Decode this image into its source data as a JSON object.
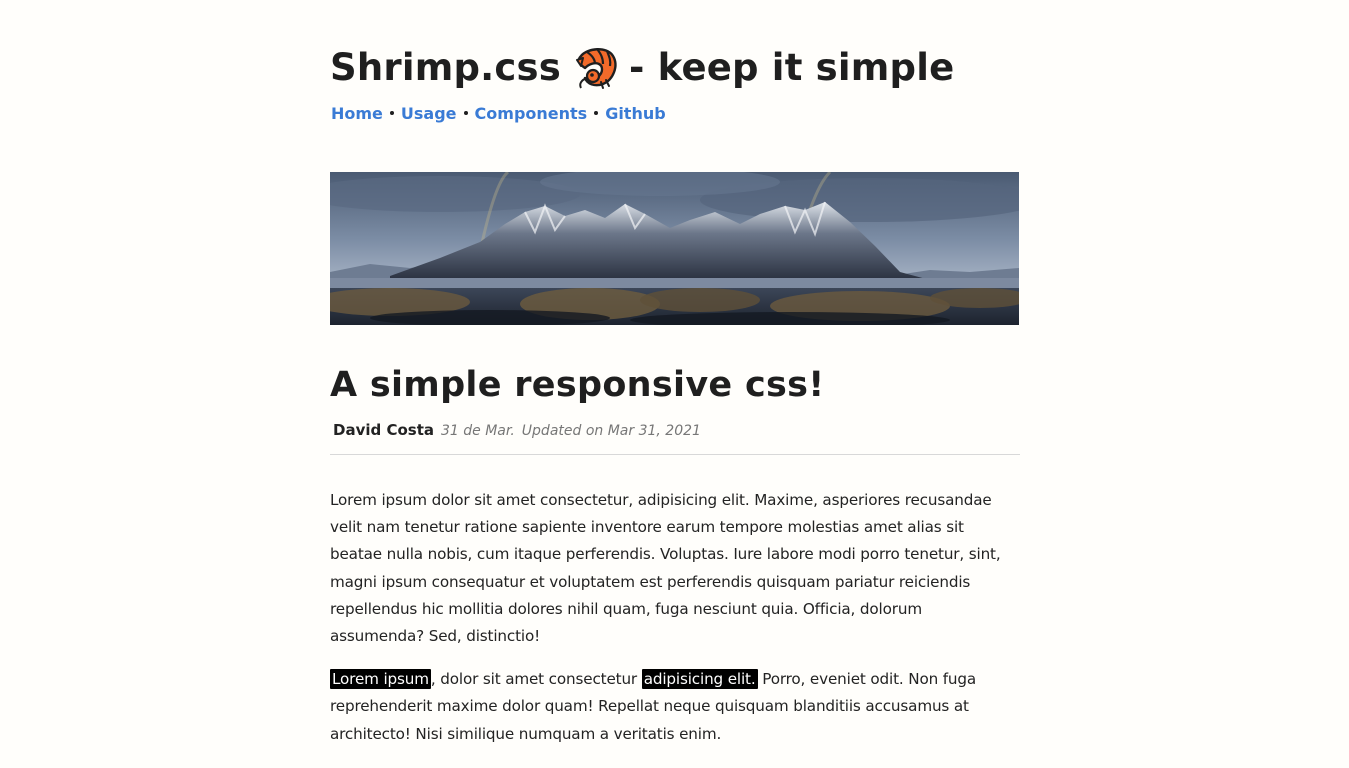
{
  "header": {
    "title_prefix": "Shrimp.css",
    "title_suffix": "- keep it simple",
    "logo_icon": "shrimp-icon"
  },
  "nav": {
    "items": [
      {
        "label": "Home"
      },
      {
        "label": "Usage"
      },
      {
        "label": "Components"
      },
      {
        "label": "Github"
      }
    ],
    "link_color": "#3a7bd5"
  },
  "hero": {
    "icon": "mountain-landscape-image"
  },
  "article": {
    "title": "A simple responsive css!",
    "author": "David Costa",
    "date": "31 de Mar.",
    "updated": "Updated on Mar 31, 2021",
    "paragraph1": "Lorem ipsum dolor sit amet consectetur, adipisicing elit. Maxime, asperiores recusandae velit nam tenetur ratione sapiente inventore earum tempore molestias amet alias sit beatae nulla nobis, cum itaque perferendis. Voluptas. Iure labore modi porro tenetur, sint, magni ipsum consequatur et voluptatem est perferendis quisquam pariatur reiciendis repellendus hic mollitia dolores nihil quam, fuga nesciunt quia. Officia, dolorum assumenda? Sed, distinctio!",
    "paragraph2": {
      "mark1": "Lorem ipsum",
      "text1": ", dolor sit amet consectetur ",
      "mark2": "adipisicing elit.",
      "text2": " Porro, eveniet odit. Non fuga reprehenderit maxime dolor quam! Repellat neque quisquam blanditiis accusamus at architecto! Nisi similique numquam a veritatis enim."
    }
  },
  "colors": {
    "background": "#fffefb",
    "text": "#1f1f1f",
    "mark_bg": "#000000",
    "mark_text": "#ffffff"
  }
}
